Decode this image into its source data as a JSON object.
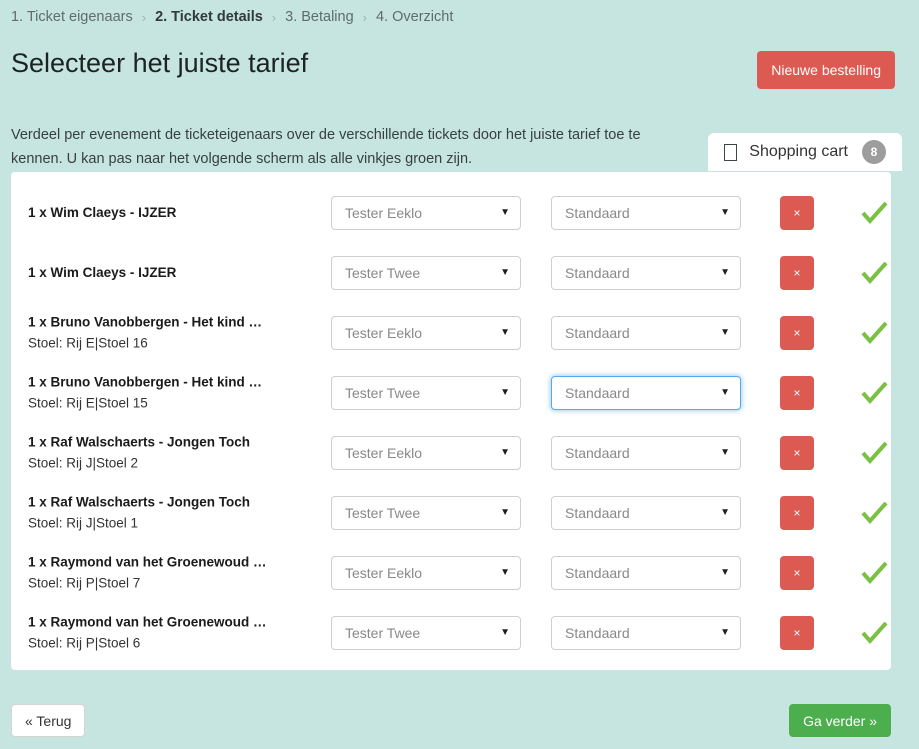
{
  "breadcrumb": {
    "separator": "›",
    "items": [
      {
        "label": "1. Ticket eigenaars",
        "active": false
      },
      {
        "label": "2. Ticket details",
        "active": true
      },
      {
        "label": "3. Betaling",
        "active": false
      },
      {
        "label": "4. Overzicht",
        "active": false
      }
    ]
  },
  "header": {
    "title": "Selecteer het juiste tarief",
    "new_order_label": "Nieuwe bestelling",
    "new_order_color": "#dd5a52"
  },
  "intro": "Verdeel per evenement de ticketeigenaars over de verschillende tickets door het juiste tarief toe te kennen.   U kan pas naar het volgende scherm als alle vinkjes groen zijn.",
  "cart": {
    "icon": "shopping-cart-icon",
    "label": "Shopping cart",
    "count": "8",
    "badge_color": "#9d9d9d"
  },
  "table": {
    "delete_label": "×",
    "caret": "▼",
    "check_color": "#7ac143",
    "rows": [
      {
        "title": "1 x Wim Claeys - IJZER",
        "seat": "",
        "owner": "Tester Eeklo",
        "tariff": "Standaard",
        "tariff_focused": false,
        "valid": true
      },
      {
        "title": "1 x Wim Claeys - IJZER",
        "seat": "",
        "owner": "Tester Twee",
        "tariff": "Standaard",
        "tariff_focused": false,
        "valid": true
      },
      {
        "title": "1 x Bruno Vanobbergen - Het kind …",
        "seat": "Stoel: Rij E|Stoel 16",
        "owner": "Tester Eeklo",
        "tariff": "Standaard",
        "tariff_focused": false,
        "valid": true
      },
      {
        "title": "1 x Bruno Vanobbergen - Het kind …",
        "seat": "Stoel: Rij E|Stoel 15",
        "owner": "Tester Twee",
        "tariff": "Standaard",
        "tariff_focused": true,
        "valid": true
      },
      {
        "title": "1 x Raf Walschaerts - Jongen Toch",
        "seat": "Stoel: Rij J|Stoel 2",
        "owner": "Tester Eeklo",
        "tariff": "Standaard",
        "tariff_focused": false,
        "valid": true
      },
      {
        "title": "1 x Raf Walschaerts - Jongen Toch",
        "seat": "Stoel: Rij J|Stoel 1",
        "owner": "Tester Twee",
        "tariff": "Standaard",
        "tariff_focused": false,
        "valid": true
      },
      {
        "title": "1 x Raymond van het Groenewoud …",
        "seat": "Stoel: Rij P|Stoel 7",
        "owner": "Tester Eeklo",
        "tariff": "Standaard",
        "tariff_focused": false,
        "valid": true
      },
      {
        "title": "1 x Raymond van het Groenewoud …",
        "seat": "Stoel: Rij P|Stoel 6",
        "owner": "Tester Twee",
        "tariff": "Standaard",
        "tariff_focused": false,
        "valid": true
      }
    ]
  },
  "footer": {
    "back_label": "« Terug",
    "next_label": "Ga verder »",
    "next_color": "#4cae4c"
  }
}
